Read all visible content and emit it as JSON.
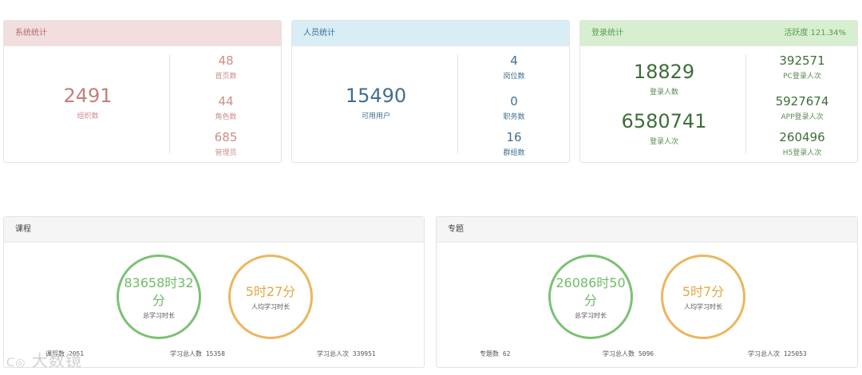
{
  "system_stats": {
    "title": "系统统计",
    "main": {
      "value": "2491",
      "label": "组织数"
    },
    "items": [
      {
        "value": "48",
        "label": "首页数"
      },
      {
        "value": "44",
        "label": "角色数"
      },
      {
        "value": "685",
        "label": "管理员"
      }
    ]
  },
  "people_stats": {
    "title": "人员统计",
    "main": {
      "value": "15490",
      "label": "可用用户"
    },
    "items": [
      {
        "value": "4",
        "label": "岗位数"
      },
      {
        "value": "0",
        "label": "职务数"
      },
      {
        "value": "16",
        "label": "群组数"
      }
    ]
  },
  "login_stats": {
    "title": "登录统计",
    "activity": "活跃度 121.34%",
    "main": [
      {
        "value": "18829",
        "label": "登录人数"
      },
      {
        "value": "6580741",
        "label": "登录人次"
      }
    ],
    "items": [
      {
        "value": "392571",
        "label": "PC登录人次"
      },
      {
        "value": "5927674",
        "label": "APP登录人次"
      },
      {
        "value": "260496",
        "label": "H5登录人次"
      }
    ]
  },
  "course": {
    "title": "课程",
    "total_time": {
      "value": "83658时32分",
      "label": "总学习时长"
    },
    "avg_time": {
      "value": "5时27分",
      "label": "人均学习时长"
    },
    "footer": {
      "count": "课程数 2051",
      "learners": "学习总人数 15358",
      "visits": "学习总人次 339951"
    }
  },
  "topic": {
    "title": "专题",
    "total_time": {
      "value": "26086时50分",
      "label": "总学习时长"
    },
    "avg_time": {
      "value": "5时7分",
      "label": "人均学习时长"
    },
    "footer": {
      "count": "专题数 62",
      "learners": "学习总人数 5096",
      "visits": "学习总人次 125053"
    }
  },
  "watermark": {
    "text": "大数镜",
    "logo": "logo-icon"
  },
  "colors": {
    "system_accent": "#c47f7a",
    "people_accent": "#3f6f8f",
    "login_accent": "#3e6e38",
    "circle_green": "#7cc175",
    "circle_orange": "#ecb65e"
  }
}
